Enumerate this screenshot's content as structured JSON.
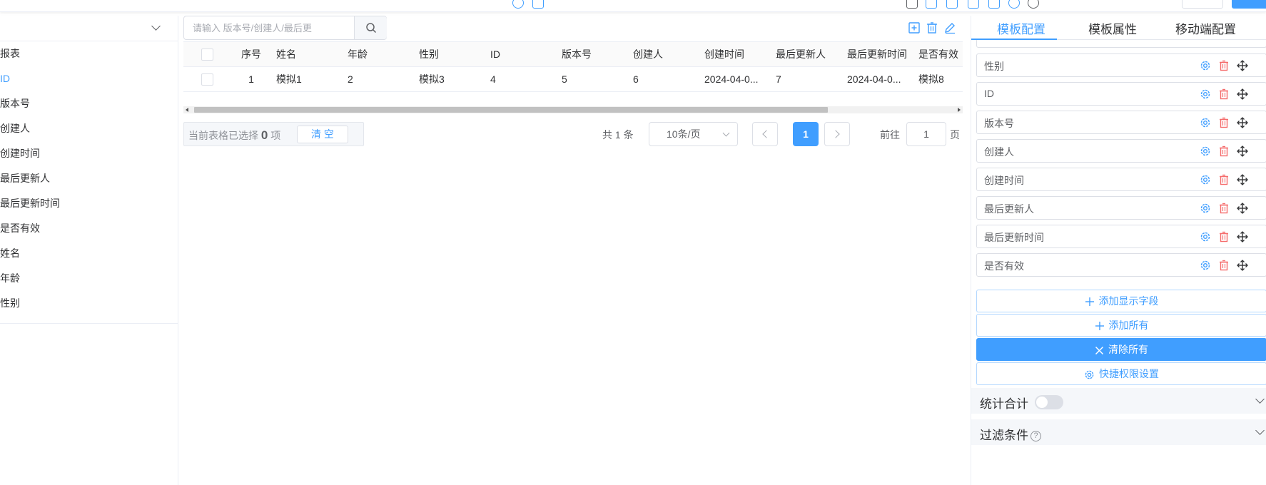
{
  "left_panel": {
    "items": [
      {
        "label": "报表"
      },
      {
        "label": "ID"
      },
      {
        "label": "版本号"
      },
      {
        "label": "创建人"
      },
      {
        "label": "创建时间"
      },
      {
        "label": "最后更新人"
      },
      {
        "label": "最后更新时间"
      },
      {
        "label": "是否有效"
      },
      {
        "label": "姓名"
      },
      {
        "label": "年龄"
      },
      {
        "label": "性别"
      }
    ]
  },
  "search": {
    "placeholder": "请输入 版本号/创建人/最后更"
  },
  "table": {
    "headers": [
      "序号",
      "姓名",
      "年龄",
      "性别",
      "ID",
      "版本号",
      "创建人",
      "创建时间",
      "最后更新人",
      "最后更新时间",
      "是否有效"
    ],
    "rows": [
      [
        "1",
        "模拟1",
        "2",
        "模拟3",
        "4",
        "5",
        "6",
        "2024-04-0...",
        "7",
        "2024-04-0...",
        "模拟8"
      ]
    ]
  },
  "selection": {
    "prefix": "当前表格已选择",
    "count": "0",
    "suffix": "项",
    "clear_label": "清 空"
  },
  "pagination": {
    "total": "共 1 条",
    "page_size": "10条/页",
    "current": "1",
    "goto_label": "前往",
    "goto_value": "1",
    "page_label": "页"
  },
  "right_panel": {
    "tabs": [
      {
        "label": "模板配置"
      },
      {
        "label": "模板属性"
      },
      {
        "label": "移动端配置"
      }
    ],
    "fields": [
      {
        "label": "性别"
      },
      {
        "label": "ID"
      },
      {
        "label": "版本号"
      },
      {
        "label": "创建人"
      },
      {
        "label": "创建时间"
      },
      {
        "label": "最后更新人"
      },
      {
        "label": "最后更新时间"
      },
      {
        "label": "是否有效"
      }
    ],
    "add_display_field": "添加显示字段",
    "add_all": "添加所有",
    "clear_all": "清除所有",
    "permission_settings": "快捷权限设置",
    "stats_total": "统计合计",
    "filter_conditions": "过滤条件"
  },
  "colors": {
    "accent": "#409eff",
    "danger": "#f56c6c",
    "border": "#dcdfe6",
    "muted": "#909399"
  }
}
